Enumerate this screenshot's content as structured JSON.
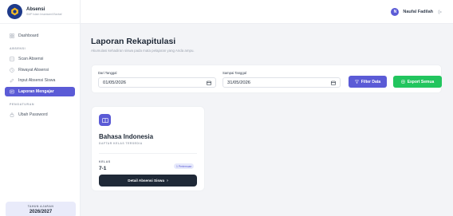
{
  "brand": {
    "name": "Absensi",
    "subtitle": "SMP Islam Insankamil Barbaf"
  },
  "sidebar": {
    "dashboard": "Dashboard",
    "section_absensi": "ABSENSI",
    "items": [
      {
        "label": "Scan Absensi"
      },
      {
        "label": "Riwayat Absensi"
      },
      {
        "label": "Input Absensi Siswa"
      },
      {
        "label": "Laporan Mengajar"
      }
    ],
    "section_pengaturan": "PENGATURAN",
    "settings": [
      {
        "label": "Ubah Password"
      }
    ],
    "year_label": "TAHUN AJARAN",
    "year_value": "2026/2027"
  },
  "topbar": {
    "avatar_initial": "N",
    "user_name": "Naufal Fadilah"
  },
  "main": {
    "title": "Laporan Rekapitulasi",
    "subtitle": "Akumulasi kehadiran siswa pada mata pelajaran yang Anda ampu.",
    "filter": {
      "from_label": "Dari Tanggal",
      "from_value": "01/05/2026",
      "to_label": "Sampai Tanggal",
      "to_value": "31/05/2026",
      "filter_button": "Filter Data",
      "export_button": "Export Semua"
    },
    "card": {
      "title": "Bahasa Indonesia",
      "subtitle": "DAFTAR KELAS TERSEDIA",
      "kelas_label": "KELAS",
      "kelas_value": "7-1",
      "badge": "1 Pertemuan",
      "detail_button": "Detail Absensi Siswa",
      "detail_chevron": "›"
    }
  },
  "colors": {
    "accent": "#5b5bd6",
    "success": "#22c55e",
    "dark": "#1f2937",
    "brand": "#1e3a8a"
  }
}
